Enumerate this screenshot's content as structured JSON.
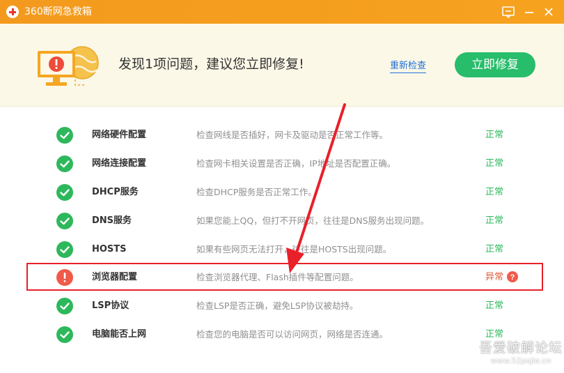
{
  "window": {
    "title": "360断网急救箱"
  },
  "header": {
    "message": "发现1项问题，建议您立即修复!",
    "recheck_label": "重新检查",
    "fix_button_label": "立即修复"
  },
  "items": [
    {
      "name": "网络硬件配置",
      "desc": "检查网线是否插好，网卡及驱动是否正常工作等。",
      "status": "正常",
      "ok": true
    },
    {
      "name": "网络连接配置",
      "desc": "检查网卡相关设置是否正确，IP地址是否配置正确。",
      "status": "正常",
      "ok": true
    },
    {
      "name": "DHCP服务",
      "desc": "检查DHCP服务是否正常工作。",
      "status": "正常",
      "ok": true
    },
    {
      "name": "DNS服务",
      "desc": "如果您能上QQ，但打不开网页，往往是DNS服务出现问题。",
      "status": "正常",
      "ok": true
    },
    {
      "name": "HOSTS",
      "desc": "如果有些网页无法打开，往往是HOSTS出现问题。",
      "status": "正常",
      "ok": true
    },
    {
      "name": "浏览器配置",
      "desc": "检查浏览器代理、Flash插件等配置问题。",
      "status": "异常",
      "ok": false
    },
    {
      "name": "LSP协议",
      "desc": "检查LSP是否正确，避免LSP协议被劫持。",
      "status": "正常",
      "ok": true
    },
    {
      "name": "电脑能否上网",
      "desc": "检查您的电脑是否可以访问网页，网络是否连通。",
      "status": "正常",
      "ok": true
    }
  ],
  "watermark": {
    "text": "吾爱破解论坛",
    "url": "www.52pojie.cn"
  },
  "colors": {
    "titlebar": "#f7a21f",
    "ok_green": "#2eb85c",
    "error_red": "#f05a4a",
    "fix_button": "#27bd6a",
    "link_blue": "#1e6fd9",
    "annotation_red": "#e8202a"
  },
  "icons": {
    "title": "red-cross-logo-icon",
    "feedback": "feedback-icon",
    "minimize": "minimize-icon",
    "close": "close-icon",
    "header": "computer-warning-icon",
    "ok": "check-circle-icon",
    "error": "exclamation-circle-icon",
    "help": "question-circle-icon"
  }
}
